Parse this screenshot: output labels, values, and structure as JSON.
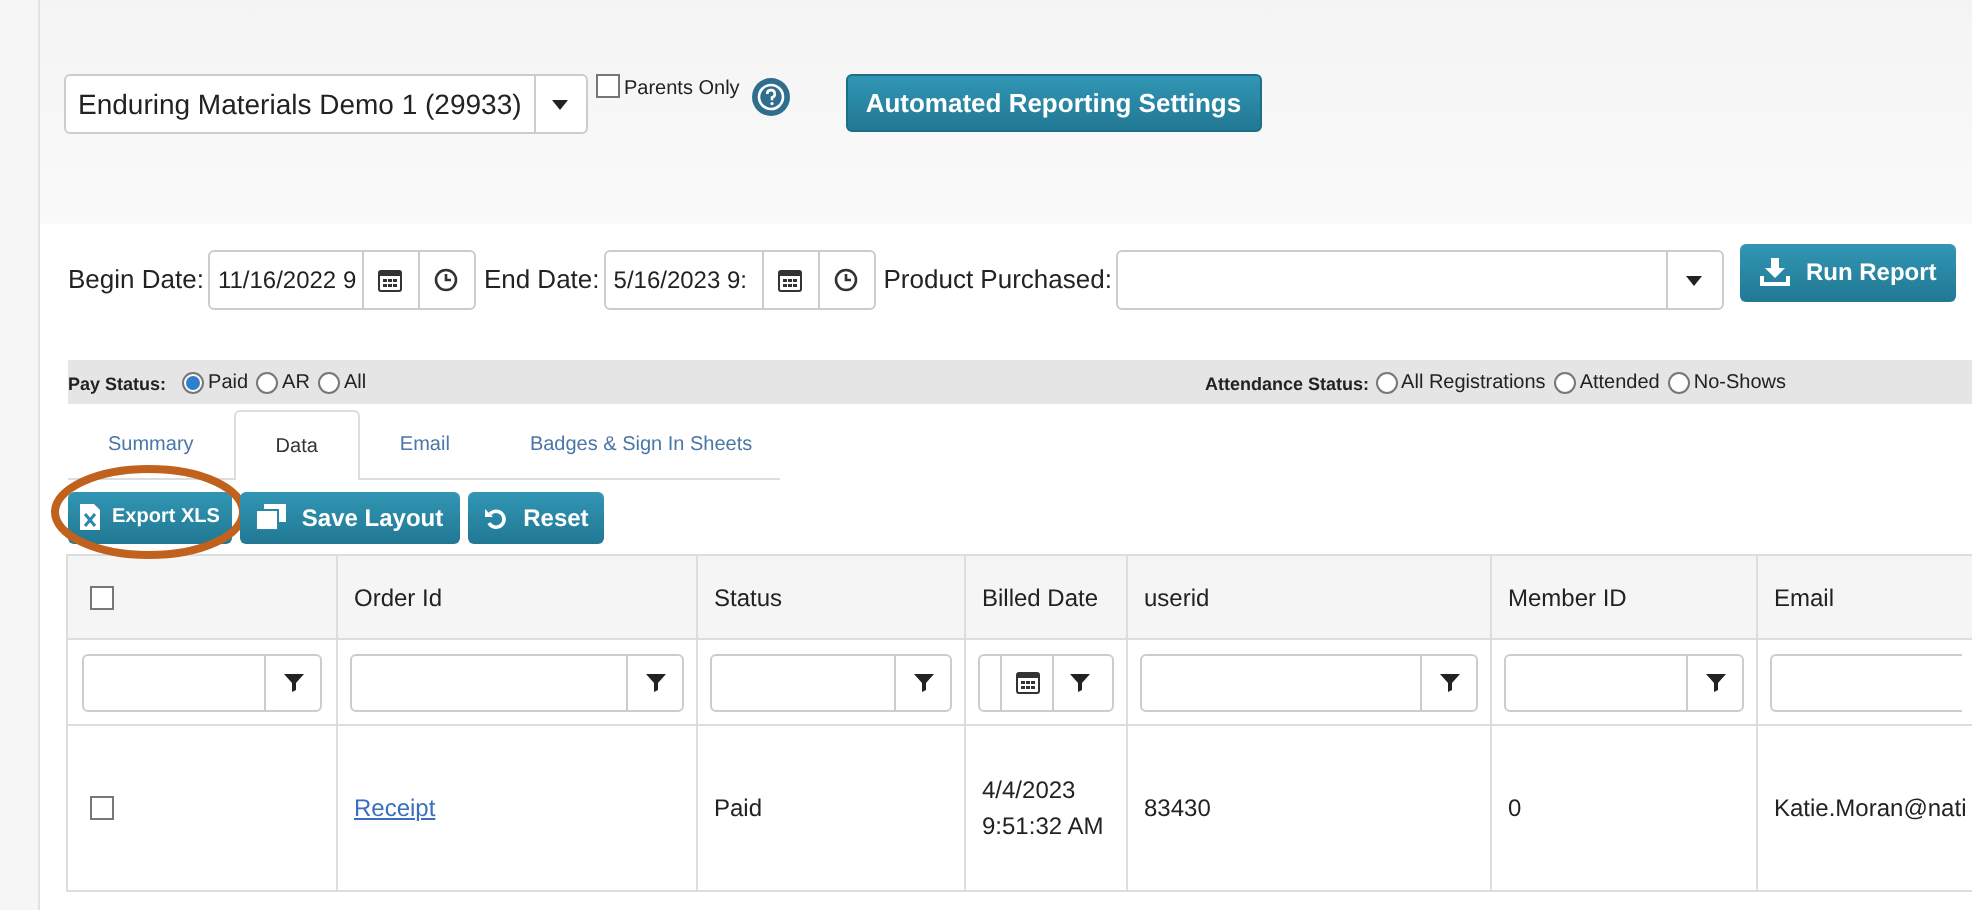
{
  "course_select": {
    "value": "Enduring Materials Demo 1 (29933)"
  },
  "parents_only": {
    "label": "Parents Only",
    "checked": false
  },
  "settings_button": {
    "label": "Automated Reporting Settings"
  },
  "date_row": {
    "begin_label": "Begin Date:",
    "begin_value": "11/16/2022 9",
    "end_label": "End Date:",
    "end_value": "5/16/2023 9:",
    "product_label": "Product Purchased:",
    "run_button": "Run Report"
  },
  "pay_status": {
    "label": "Pay Status:",
    "options": [
      {
        "label": "Paid",
        "selected": true
      },
      {
        "label": "AR",
        "selected": false
      },
      {
        "label": "All",
        "selected": false
      }
    ]
  },
  "attendance_status": {
    "label": "Attendance Status:",
    "options": [
      {
        "label": "All Registrations",
        "selected": false
      },
      {
        "label": "Attended",
        "selected": false
      },
      {
        "label": "No-Shows",
        "selected": false
      }
    ]
  },
  "tabs": [
    {
      "label": "Summary",
      "selected": false
    },
    {
      "label": "Data",
      "selected": true
    },
    {
      "label": "Email",
      "selected": false
    },
    {
      "label": "Badges & Sign In Sheets",
      "selected": false
    }
  ],
  "toolbar": [
    {
      "label": "Export XLS",
      "kind": "export",
      "highlighted": true
    },
    {
      "label": "Save Layout",
      "kind": "save",
      "highlighted": false
    },
    {
      "label": "Reset",
      "kind": "reset",
      "highlighted": false
    }
  ],
  "table": {
    "select_all_checked": false,
    "columns": [
      {
        "label": "Order Id",
        "kind": "text"
      },
      {
        "label": "Status",
        "kind": "text"
      },
      {
        "label": "Billed Date",
        "kind": "date"
      },
      {
        "label": "userid",
        "kind": "text"
      },
      {
        "label": "Member ID",
        "kind": "text"
      },
      {
        "label": "Email",
        "kind": "field"
      }
    ],
    "rows": [
      {
        "checked": false,
        "cells": [
          {
            "text": "Receipt",
            "kind": "link"
          },
          {
            "text": "Paid",
            "kind": "text"
          },
          {
            "text": "4/4/2023 9:51:32 AM",
            "kind": "text"
          },
          {
            "text": "83430",
            "kind": "text"
          },
          {
            "text": "0",
            "kind": "text"
          },
          {
            "text": "Katie.Moran@nati",
            "kind": "text"
          }
        ]
      }
    ]
  }
}
